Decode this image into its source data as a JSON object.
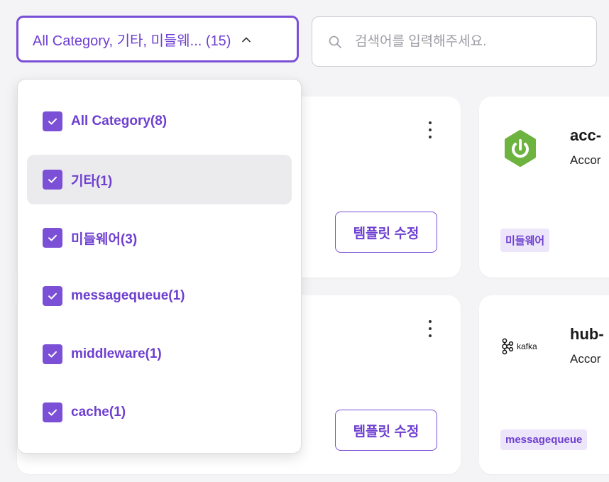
{
  "filter": {
    "select_label": "All Category, 기타, 미들웨... (15)",
    "options": [
      {
        "label": "All Category(8)",
        "checked": true
      },
      {
        "label": "기타(1)",
        "checked": true
      },
      {
        "label": "미들웨어(3)",
        "checked": true
      },
      {
        "label": "messagequeue(1)",
        "checked": true
      },
      {
        "label": "middleware(1)",
        "checked": true
      },
      {
        "label": "cache(1)",
        "checked": true
      }
    ]
  },
  "search": {
    "placeholder": "검색어를 입력해주세요."
  },
  "cards": [
    {
      "edit_label": "템플릿 수정"
    },
    {
      "edit_label": "템플릿 수정"
    },
    {
      "title": "acc-",
      "subtitle": "Accor",
      "tag": "미들웨어",
      "logo": "spring-power-icon"
    },
    {
      "title": "hub-",
      "subtitle": "Accor",
      "tag": "messagequeue",
      "logo": "kafka-logo",
      "logo_text": "kafka"
    }
  ],
  "colors": {
    "accent": "#7b4fd6",
    "accent_text": "#6d3fd0",
    "tag_bg": "#ede5fa",
    "spring_green": "#6db33f"
  }
}
